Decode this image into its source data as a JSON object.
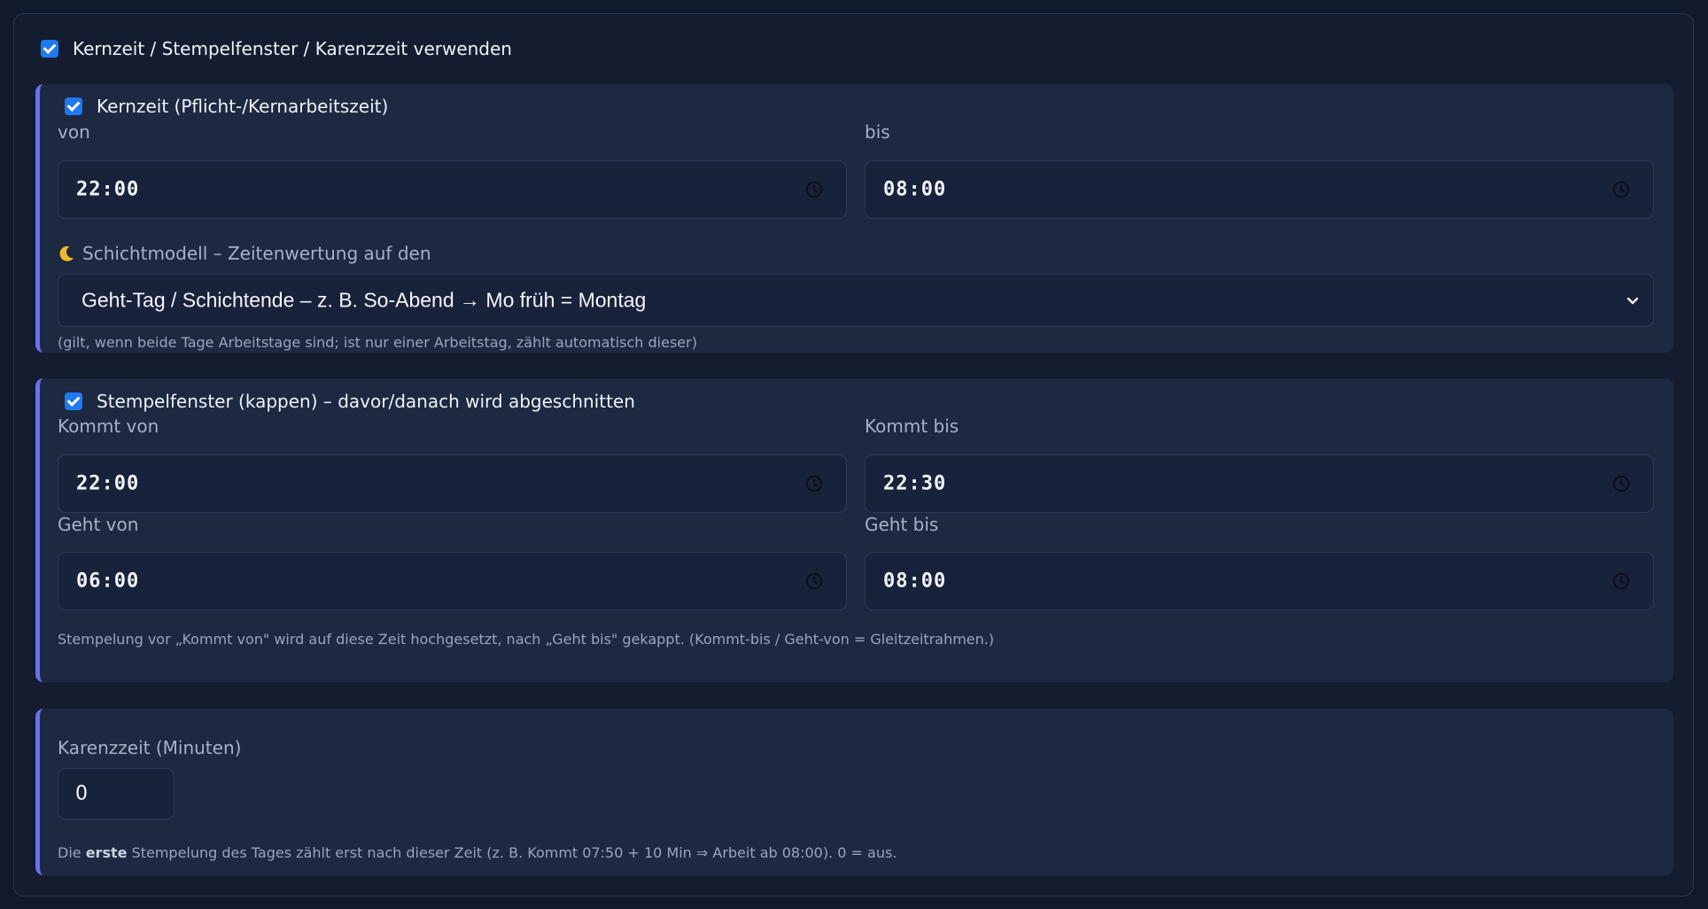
{
  "main_toggle": {
    "label": "Kernzeit / Stempelfenster / Karenzzeit verwenden",
    "checked": true
  },
  "kernzeit": {
    "toggle_label": "Kernzeit (Pflicht-/Kernarbeitszeit)",
    "checked": true,
    "von_label": "von",
    "von_value": "22:00",
    "bis_label": "bis",
    "bis_value": "08:00",
    "shift_label": "Schichtmodell – Zeitenwertung auf den",
    "shift_icon": "moon-icon",
    "shift_selected": "Geht-Tag / Schichtende – z. B. So-Abend → Mo früh = Montag",
    "hint": "(gilt, wenn beide Tage Arbeitstage sind; ist nur einer Arbeitstag, zählt automatisch dieser)"
  },
  "stempelfenster": {
    "toggle_label": "Stempelfenster (kappen) – davor/danach wird abgeschnitten",
    "checked": true,
    "kommt_von_label": "Kommt von",
    "kommt_von_value": "22:00",
    "kommt_bis_label": "Kommt bis",
    "kommt_bis_value": "22:30",
    "geht_von_label": "Geht von",
    "geht_von_value": "06:00",
    "geht_bis_label": "Geht bis",
    "geht_bis_value": "08:00",
    "hint": "Stempelung vor „Kommt von\" wird auf diese Zeit hochgesetzt, nach „Geht bis\" gekappt. (Kommt-bis / Geht-von = Gleitzeitrahmen.)"
  },
  "karenzzeit": {
    "label": "Karenzzeit (Minuten)",
    "value": "0",
    "hint_prefix": "Die ",
    "hint_bold": "erste",
    "hint_suffix": " Stempelung des Tages zählt erst nach dieser Zeit (z. B. Kommt 07:50 + 10 Min ⇒ Arbeit ab 08:00). 0 = aus."
  },
  "colors": {
    "accent": "#6b6ff3",
    "checkbox": "#1f7aef",
    "panel": "#1d2841",
    "background": "#111a2b"
  }
}
